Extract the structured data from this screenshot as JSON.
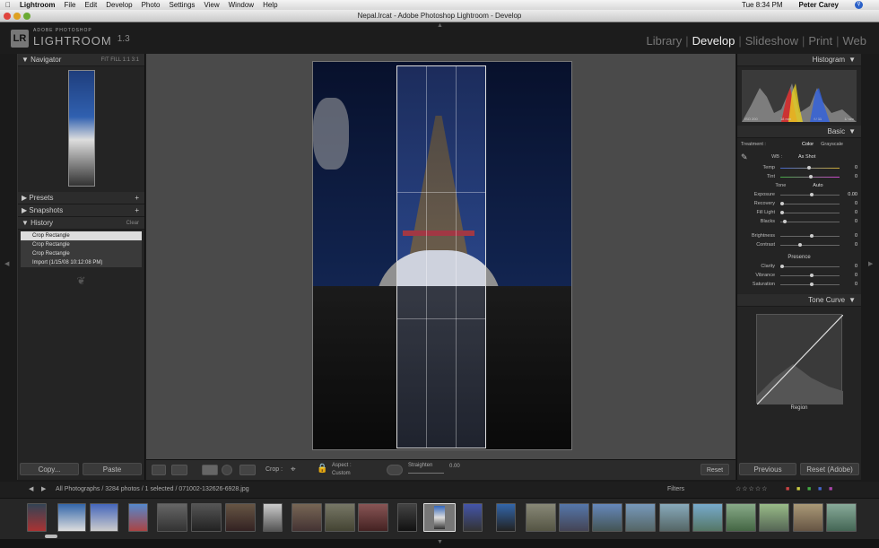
{
  "menubar": {
    "app": "Lightroom",
    "items": [
      "File",
      "Edit",
      "Develop",
      "Photo",
      "Settings",
      "View",
      "Window",
      "Help"
    ],
    "time": "Tue 8:34 PM",
    "user": "Peter Carey"
  },
  "window": {
    "title": "Nepal.lrcat - Adobe Photoshop Lightroom - Develop"
  },
  "logo": {
    "badge": "LR",
    "small": "ADOBE PHOTOSHOP",
    "big": "LIGHTROOM",
    "version": "1.3"
  },
  "modules": [
    "Library",
    "Develop",
    "Slideshow",
    "Print",
    "Web"
  ],
  "left": {
    "navigator": "Navigator",
    "nav_opts": "FIT  FILL  1:1  3:1",
    "presets": "Presets",
    "snapshots": "Snapshots",
    "history": "History",
    "clear": "Clear",
    "history_items": [
      "Crop Rectangle",
      "Crop Rectangle",
      "Crop Rectangle",
      "Import (1/15/08 10:12:08 PM)"
    ],
    "copy": "Copy...",
    "paste": "Paste"
  },
  "toolbar": {
    "crop": "Crop :",
    "aspect": "Aspect :",
    "custom": "Custom",
    "straighten": "Straighten",
    "angle": "0.00",
    "reset": "Reset"
  },
  "right": {
    "histogram": "Histogram",
    "iso": "ISO 200",
    "focal": "18 mm",
    "aperture": "f / 11",
    "shutter": "1/ sec",
    "basic": "Basic",
    "treatment": "Treatment :",
    "color": "Color",
    "grayscale": "Grayscale",
    "wb": "WB :",
    "wb_val": "As Shot",
    "temp": "Temp",
    "tint": "Tint",
    "tone": "Tone",
    "auto": "Auto",
    "exposure": "Exposure",
    "exposure_val": "0.00",
    "recovery": "Recovery",
    "filllight": "Fill Light",
    "blacks": "Blacks",
    "brightness": "Brightness",
    "contrast": "Contrast",
    "presence": "Presence",
    "clarity": "Clarity",
    "vibrance": "Vibrance",
    "saturation": "Saturation",
    "zero": "0",
    "tonecurve": "Tone Curve",
    "region": "Region",
    "previous": "Previous",
    "reset_adobe": "Reset (Adobe)"
  },
  "filmstrip": {
    "info": "All Photographs / 3284 photos / 1 selected / 071002-132626-6928.jpg",
    "filters": "Filters"
  }
}
